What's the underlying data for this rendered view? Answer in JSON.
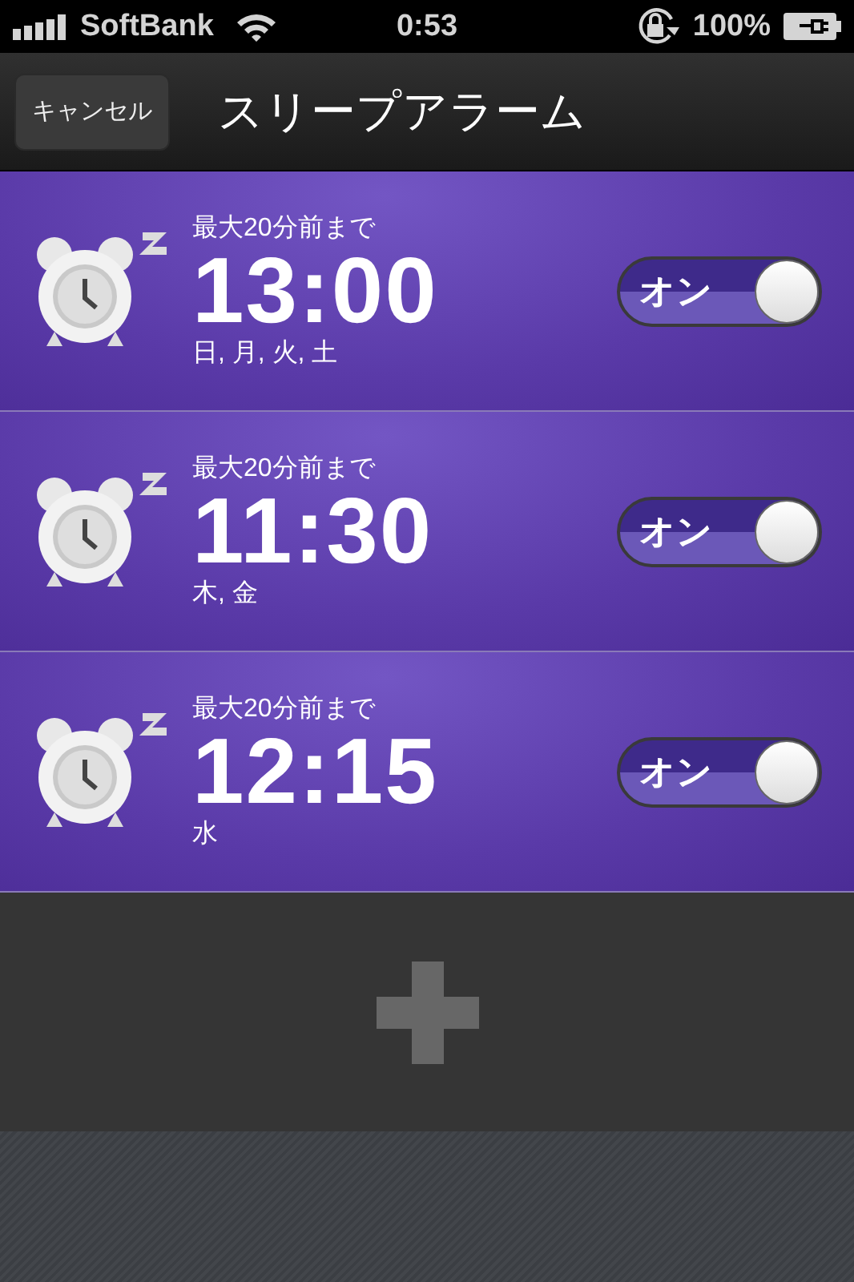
{
  "status_bar": {
    "carrier": "SoftBank",
    "time": "0:53",
    "battery": "100%"
  },
  "nav_bar": {
    "cancel_button": "キャンセル",
    "title": "スリープアラーム"
  },
  "alarms": [
    {
      "note": "最大20分前まで",
      "time": "13:00",
      "days": "日, 月, 火, 土",
      "toggle": {
        "label": "オン",
        "on": true
      }
    },
    {
      "note": "最大20分前まで",
      "time": "11:30",
      "days": "木, 金",
      "toggle": {
        "label": "オン",
        "on": true
      }
    },
    {
      "note": "最大20分前まで",
      "time": "12:15",
      "days": "水",
      "toggle": {
        "label": "オン",
        "on": true
      }
    }
  ]
}
